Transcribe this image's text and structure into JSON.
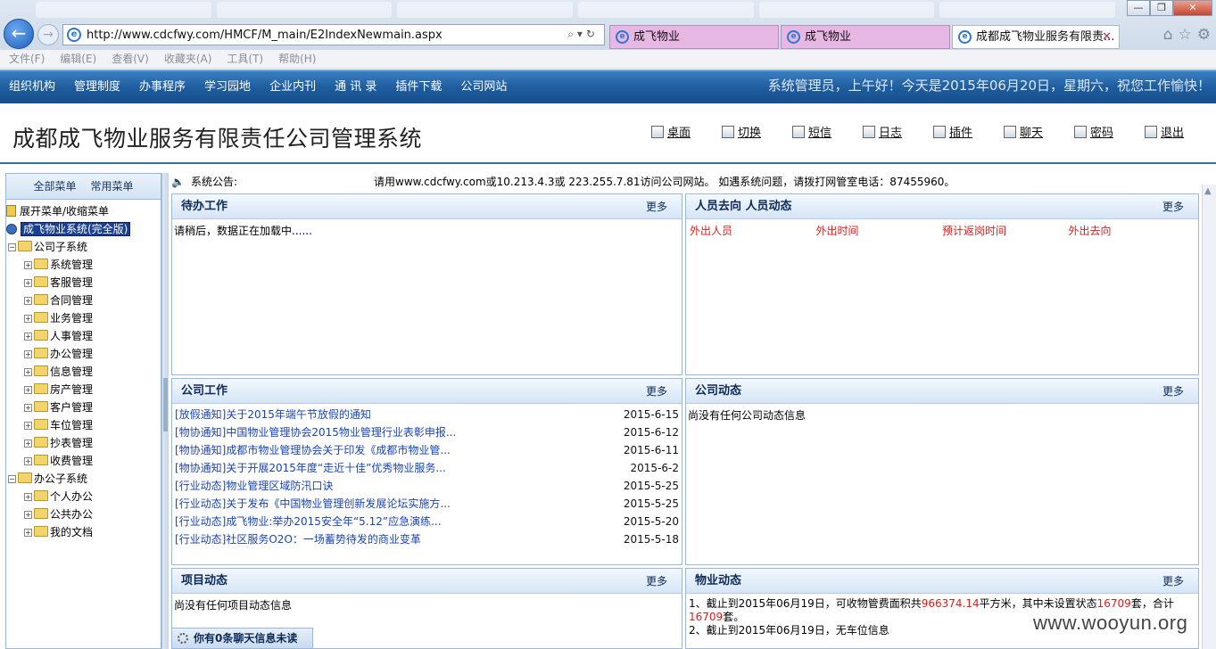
{
  "browser": {
    "url": "http://www.cdcfwy.com/HMCF/M_main/E2IndexNewmain.aspx",
    "tabs": [
      {
        "title": "成飞物业",
        "active": false
      },
      {
        "title": "成飞物业",
        "active": false
      },
      {
        "title": "成都成飞物业服务有限责...",
        "active": true
      }
    ],
    "menu": [
      "文件(F)",
      "编辑(E)",
      "查看(V)",
      "收藏夹(A)",
      "工具(T)",
      "帮助(H)"
    ]
  },
  "nav": {
    "items": [
      "组织机构",
      "管理制度",
      "办事程序",
      "学习园地",
      "企业内刊",
      "通 讯 录",
      "插件下载",
      "公司网站"
    ],
    "greeting": "系统管理员，上午好！今天是2015年06月20日，星期六，祝您工作愉快！"
  },
  "header": {
    "title": "成都成飞物业服务有限责任公司管理系统",
    "tools": [
      "桌面",
      "切换",
      "短信",
      "日志",
      "插件",
      "聊天",
      "密码",
      "退出"
    ]
  },
  "sidebar": {
    "tabs": [
      "全部菜单",
      "常用菜单"
    ],
    "toggle": "展开菜单/收缩菜单",
    "root": "成飞物业系统(完全版)",
    "company_group": "公司子系统",
    "company_items": [
      "系统管理",
      "客服管理",
      "合同管理",
      "业务管理",
      "人事管理",
      "办公管理",
      "信息管理",
      "房产管理",
      "客户管理",
      "车位管理",
      "抄表管理",
      "收费管理"
    ],
    "office_group": "办公子系统",
    "office_items": [
      "个人办公",
      "公共办公",
      "我的文档"
    ]
  },
  "notice": {
    "label": "系统公告:",
    "text": "请用www.cdcfwy.com或10.213.4.3或 223.255.7.81访问公司网站。 如遇系统问题，请拨打网管室电话：87455960。"
  },
  "panels": {
    "more": "更多",
    "todo": {
      "title": "待办工作",
      "loading": "请稍后，数据正在加载中......"
    },
    "people": {
      "title": "人员去向  人员动态",
      "columns": [
        "外出人员",
        "外出时间",
        "预计返岗时间",
        "外出去向"
      ]
    },
    "company_work": {
      "title": "公司工作",
      "items": [
        {
          "text": "[放假通知]关于2015年端午节放假的通知",
          "date": "2015-6-15"
        },
        {
          "text": "[物协通知]中国物业管理协会2015物业管理行业表彰申报...",
          "date": "2015-6-12"
        },
        {
          "text": "[物协通知]成都市物业管理协会关于印发《成都市物业管...",
          "date": "2015-6-11"
        },
        {
          "text": "[物协通知]关于开展2015年度“走近十佳”优秀物业服务...",
          "date": "2015-6-2"
        },
        {
          "text": "[行业动态]物业管理区域防汛口诀",
          "date": "2015-5-25"
        },
        {
          "text": "[行业动态]关于发布《中国物业管理创新发展论坛实施方...",
          "date": "2015-5-25"
        },
        {
          "text": "[行业动态]成飞物业:举办2015安全年“5.12”应急演练...",
          "date": "2015-5-20"
        },
        {
          "text": "[行业动态]社区服务O2O：一场蓄势待发的商业变革",
          "date": "2015-5-18"
        }
      ]
    },
    "company_news": {
      "title": "公司动态",
      "empty": "尚没有任何公司动态信息"
    },
    "project": {
      "title": "项目动态",
      "empty": "尚没有任何项目动态信息"
    },
    "property": {
      "title": "物业动态",
      "line1_a": "1、截止到2015年06月19日，可收物管费面积共",
      "area": "966374.14",
      "line1_b": "平方米，其中未设置状态",
      "unset": "16709",
      "line1_c": "套，合计",
      "total": "16709",
      "line1_d": "套。",
      "line2": "2、截止到2015年06月19日，无车位信息"
    }
  },
  "chat": {
    "text": "你有0条聊天信息未读"
  },
  "watermark": "www.wooyun.org"
}
